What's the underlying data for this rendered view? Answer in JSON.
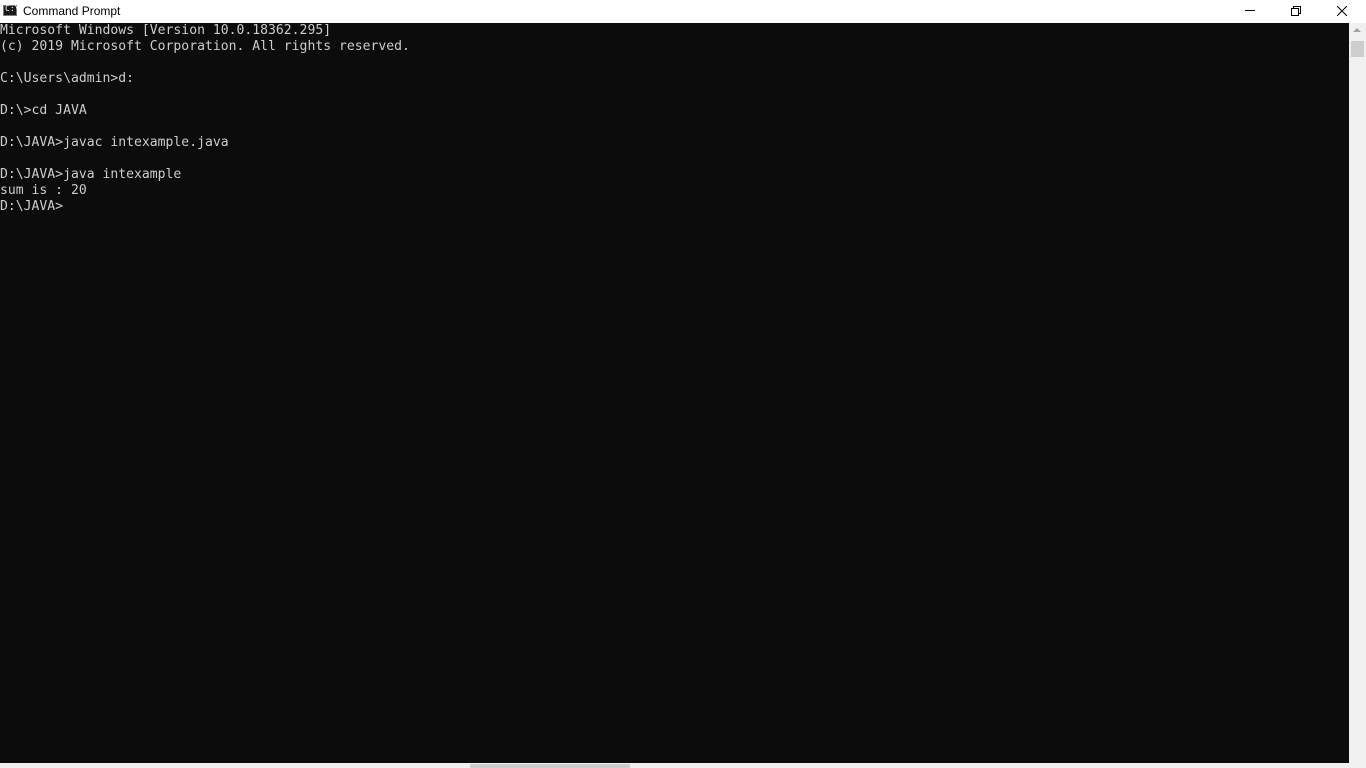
{
  "window": {
    "title": "Command Prompt",
    "icon": "cmd-icon",
    "controls": {
      "minimize": "minimize-icon",
      "maximize": "restore-icon",
      "close": "close-icon"
    }
  },
  "console": {
    "lines": [
      "Microsoft Windows [Version 10.0.18362.295]",
      "(c) 2019 Microsoft Corporation. All rights reserved.",
      "",
      "C:\\Users\\admin>d:",
      "",
      "D:\\>cd JAVA",
      "",
      "D:\\JAVA>javac intexample.java",
      "",
      "D:\\JAVA>java intexample",
      "sum is : 20",
      "D:\\JAVA>"
    ]
  },
  "colors": {
    "console_background": "#0c0c0c",
    "console_text": "#cccccc",
    "titlebar_background": "#ffffff"
  }
}
